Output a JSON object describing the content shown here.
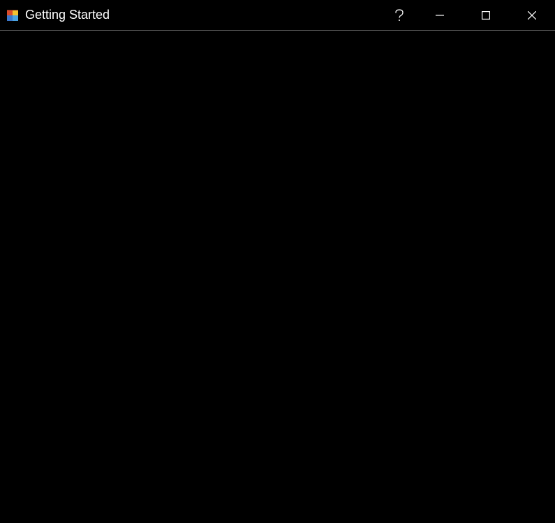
{
  "window": {
    "title": "Getting Started"
  }
}
